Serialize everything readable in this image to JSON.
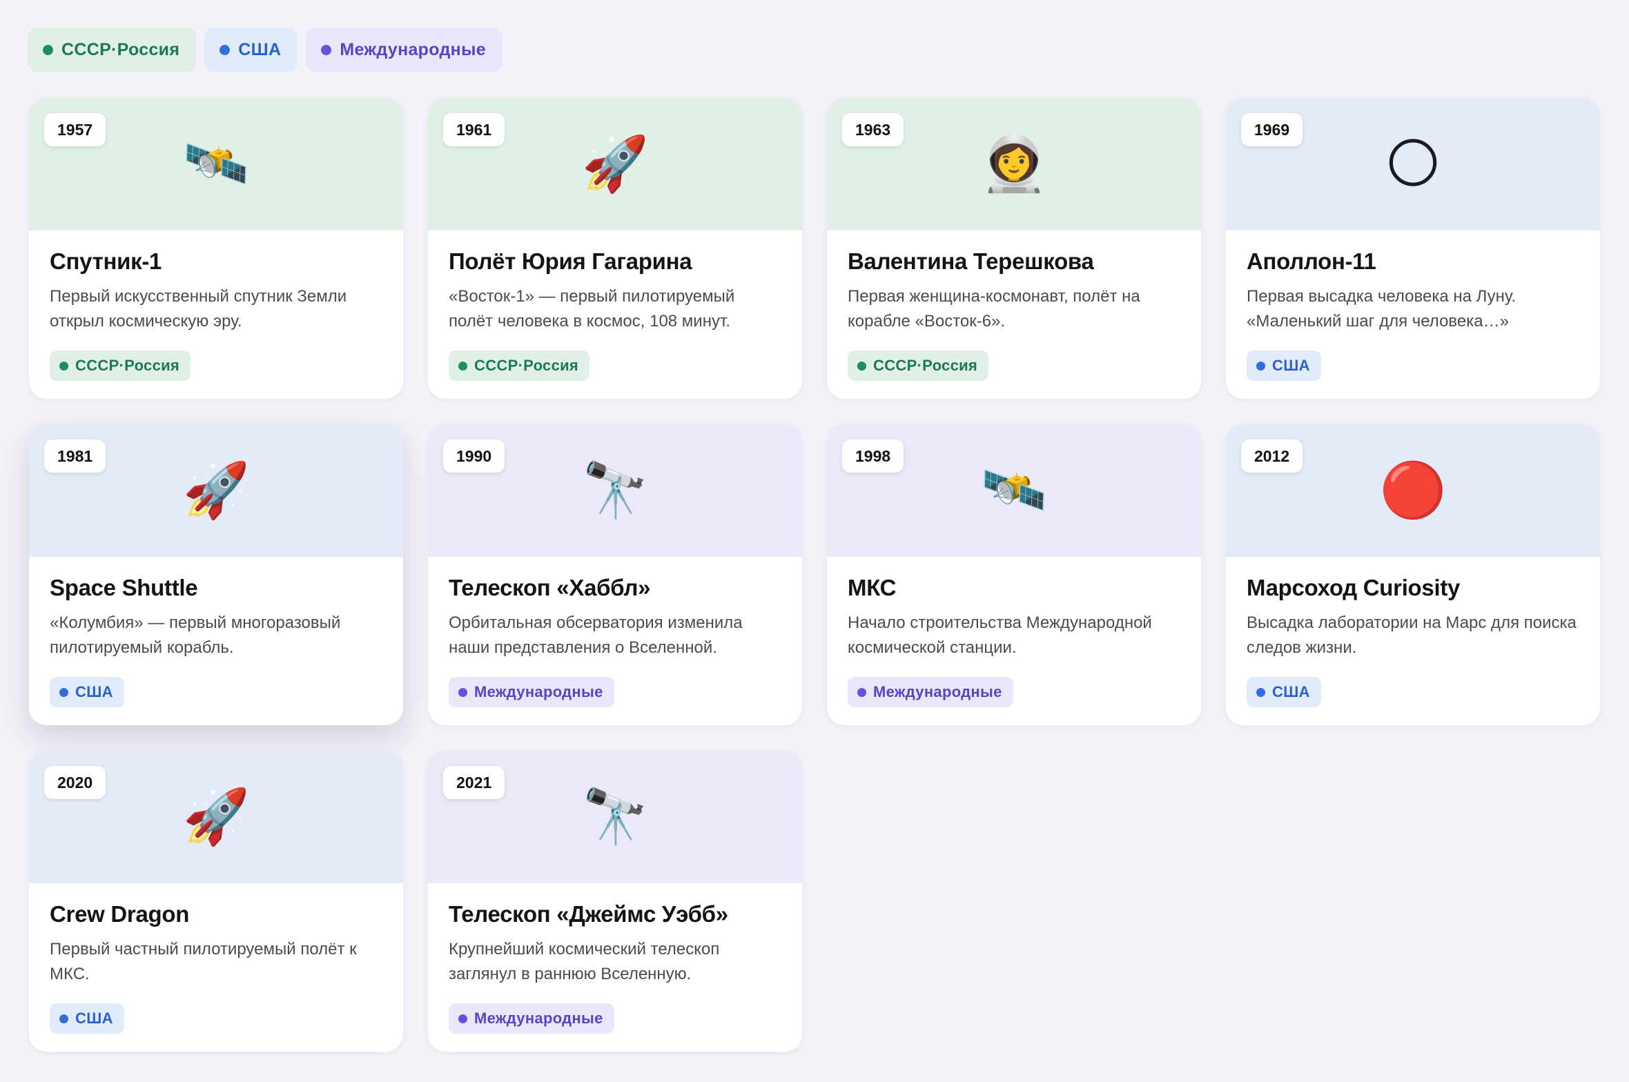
{
  "categories": {
    "ussr": {
      "label": "СССР·Россия",
      "bg": "#e1f0e7",
      "fg": "#1d7a4e",
      "dot": "#1f8f5a",
      "top": "#e1f0e7"
    },
    "usa": {
      "label": "США",
      "bg": "#e1ebfa",
      "fg": "#2a62c9",
      "dot": "#2f6fdd",
      "top": "#e3ebf8"
    },
    "intl": {
      "label": "Международные",
      "bg": "#ebe7fb",
      "fg": "#5b43c4",
      "dot": "#6b4fd8",
      "top": "#ebe8f9"
    }
  },
  "legend": [
    {
      "category": "ussr",
      "label": "СССР·Россия"
    },
    {
      "category": "usa",
      "label": "США"
    },
    {
      "category": "intl",
      "label": "Международные"
    }
  ],
  "cards": [
    {
      "year": "1957",
      "icon": "satellite-icon",
      "emoji": "🛰️",
      "title": "Спутник-1",
      "desc": "Первый искусственный спутник Земли открыл космическую эру.",
      "category": "ussr",
      "tag": "СССР·Россия"
    },
    {
      "year": "1961",
      "icon": "rocket-icon",
      "emoji": "🚀",
      "title": "Полёт Юрия Гагарина",
      "desc": "«Восток-1» — первый пилотируемый полёт человека в космос, 108 минут.",
      "category": "ussr",
      "tag": "СССР·Россия"
    },
    {
      "year": "1963",
      "icon": "astronaut-icon",
      "emoji": "👩‍🚀",
      "title": "Валентина Терешкова",
      "desc": "Первая женщина-космонавт, полёт на корабле «Восток-6».",
      "category": "ussr",
      "tag": "СССР·Россия"
    },
    {
      "year": "1969",
      "icon": "moon-icon",
      "emoji": "🌕",
      "title": "Аполлон-11",
      "desc": "Первая высадка человека на Луну. «Маленький шаг для человека…»",
      "category": "usa",
      "tag": "США"
    },
    {
      "year": "1981",
      "icon": "rocket-icon",
      "emoji": "🚀",
      "title": "Space Shuttle",
      "desc": "«Колумбия» — первый многоразовый пилотируемый корабль.",
      "category": "usa",
      "tag": "США",
      "elevated": true
    },
    {
      "year": "1990",
      "icon": "telescope-icon",
      "emoji": "🔭",
      "title": "Телескоп «Хаббл»",
      "desc": "Орбитальная обсерватория изменила наши представления о Вселенной.",
      "category": "intl",
      "tag": "Международные"
    },
    {
      "year": "1998",
      "icon": "satellite-icon",
      "emoji": "🛰️",
      "title": "МКС",
      "desc": "Начало строительства Международной космической станции.",
      "category": "intl",
      "tag": "Международные"
    },
    {
      "year": "2012",
      "icon": "mars-icon",
      "emoji": "🔴",
      "title": "Марсоход Curiosity",
      "desc": "Высадка лаборатории на Марс для поиска следов жизни.",
      "category": "usa",
      "tag": "США"
    },
    {
      "year": "2020",
      "icon": "rocket-icon",
      "emoji": "🚀",
      "title": "Crew Dragon",
      "desc": "Первый частный пилотируемый полёт к МКС.",
      "category": "usa",
      "tag": "США"
    },
    {
      "year": "2021",
      "icon": "telescope-icon",
      "emoji": "🔭",
      "title": "Телескоп «Джеймс Уэбб»",
      "desc": "Крупнейший космический телескоп заглянул в раннюю Вселенную.",
      "category": "intl",
      "tag": "Международные"
    }
  ]
}
